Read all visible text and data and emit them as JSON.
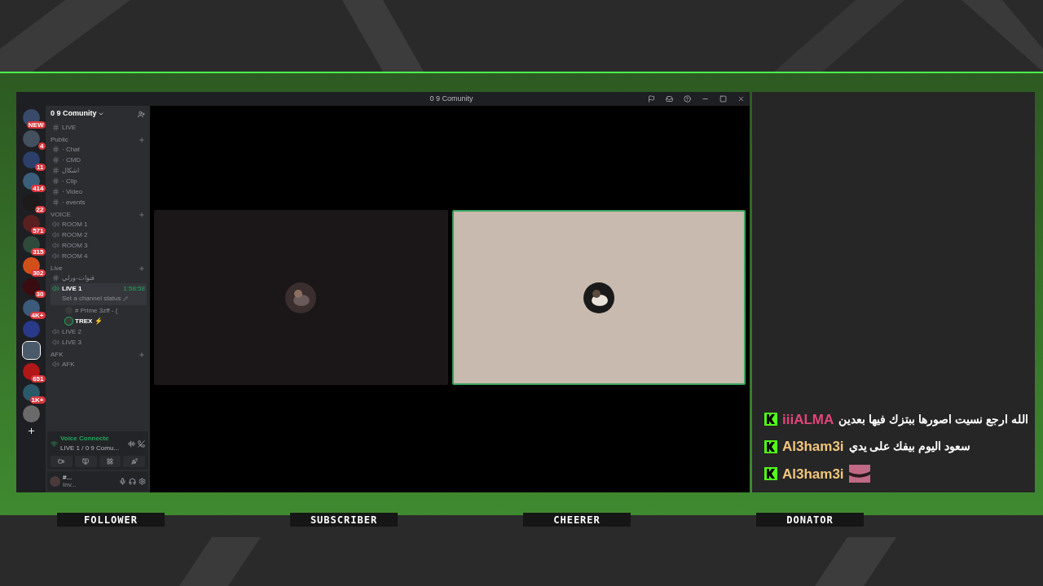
{
  "window": {
    "title": "0 9 Comunity",
    "buttons": [
      {
        "kind": "flag"
      },
      {
        "kind": "inbox"
      },
      {
        "kind": "help"
      },
      {
        "kind": "minimize"
      },
      {
        "kind": "maximize"
      },
      {
        "kind": "close"
      }
    ]
  },
  "servers": [
    {
      "badge": "NEW",
      "selected": false
    },
    {
      "badge": "4",
      "selected": false
    },
    {
      "badge": "11",
      "selected": false
    },
    {
      "badge": "414",
      "selected": false
    },
    {
      "badge": "22",
      "selected": false
    },
    {
      "badge": "571",
      "selected": false
    },
    {
      "badge": "315",
      "selected": false
    },
    {
      "badge": "302",
      "selected": false
    },
    {
      "badge": "30",
      "selected": false
    },
    {
      "badge": "4K+",
      "selected": false
    },
    {
      "selected": false
    },
    {
      "selected": true
    },
    {
      "badge": "651",
      "selected": false
    },
    {
      "badge": "1K+",
      "selected": false
    },
    {
      "selected": false
    }
  ],
  "server_header": {
    "name": "0 9 Comunity"
  },
  "channels": [
    {
      "kind": "text",
      "name": "LIVE",
      "selected": false
    },
    {
      "kind": "category",
      "name": "Public",
      "children": [
        {
          "kind": "text",
          "name": "· Chat",
          "selected": false
        },
        {
          "kind": "text",
          "name": "· CMD",
          "selected": false
        },
        {
          "kind": "text",
          "name": "اشكال",
          "selected": false
        },
        {
          "kind": "text",
          "name": "· Clip",
          "selected": false
        },
        {
          "kind": "text",
          "name": "· Video",
          "selected": false
        },
        {
          "kind": "text",
          "name": "· events",
          "selected": false
        }
      ]
    },
    {
      "kind": "category",
      "name": "VOICE",
      "children": [
        {
          "kind": "voice",
          "name": "ROOM 1",
          "selected": false
        },
        {
          "kind": "voice",
          "name": "ROOM 2",
          "selected": false
        },
        {
          "kind": "voice",
          "name": "ROOM 3",
          "selected": false
        },
        {
          "kind": "voice",
          "name": "ROOM 4",
          "selected": false
        }
      ]
    },
    {
      "kind": "category",
      "name": "Live",
      "children": [
        {
          "kind": "text",
          "name": "قنوات-ورلي",
          "selected": false
        },
        {
          "kind": "voice",
          "name": "LIVE 1",
          "selected": true,
          "time": "1:58:58",
          "status": "Set a channel status",
          "children": [
            {
              "kind": "user",
              "name": "# Prime 3zff - (",
              "speaking": false
            },
            {
              "kind": "user",
              "name": "TREX ⚡",
              "speaking": true
            }
          ]
        },
        {
          "kind": "voice",
          "name": "LIVE 2",
          "selected": false
        },
        {
          "kind": "voice",
          "name": "LIVE 3",
          "selected": false
        }
      ]
    },
    {
      "kind": "category",
      "name": "AFK",
      "children": [
        {
          "kind": "voice",
          "name": "AFK",
          "selected": false
        }
      ]
    }
  ],
  "voice_panel": {
    "status": "Voice Connecte",
    "location": "LIVE 1 / 0 9 Comu..."
  },
  "user_panel": {
    "name": "#...",
    "status": "Inv..."
  },
  "video_tiles": [
    {
      "speaking": false
    },
    {
      "speaking": true
    }
  ],
  "chat": [
    {
      "user": "iiiALMA",
      "color": "#e0457b",
      "text": "الله ارجع نسيت اصورها ببتزك فيها بعدين"
    },
    {
      "user": "Al3ham3i",
      "color": "#f2c57c",
      "text": "سعود اليوم بيفك على يدي"
    },
    {
      "user": "Al3ham3i",
      "color": "#f2c57c",
      "kind": "emote"
    }
  ],
  "stats": [
    {
      "label": "FOLLOWER"
    },
    {
      "label": "SUBSCRIBER"
    },
    {
      "label": "CHEERER"
    },
    {
      "label": "DONATOR"
    }
  ]
}
